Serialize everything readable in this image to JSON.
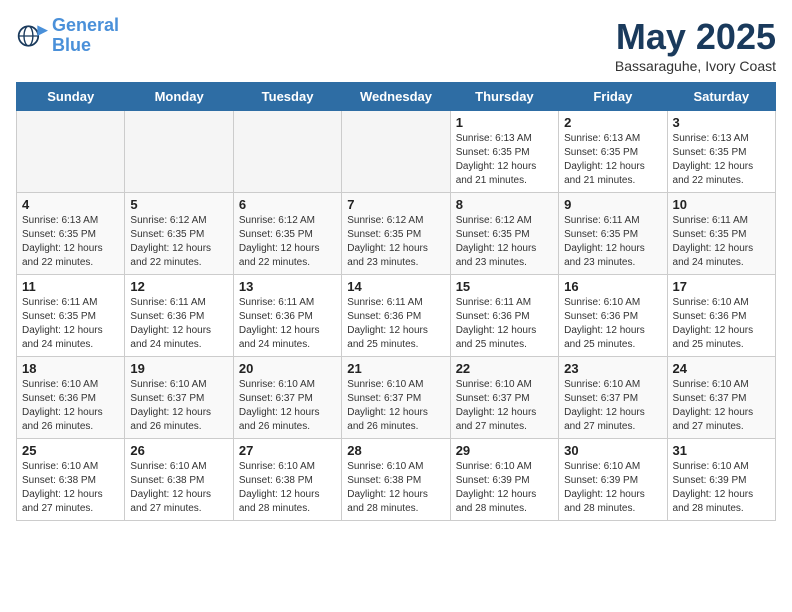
{
  "header": {
    "logo_line1": "General",
    "logo_line2": "Blue",
    "month": "May 2025",
    "location": "Bassaraguhe, Ivory Coast"
  },
  "days_of_week": [
    "Sunday",
    "Monday",
    "Tuesday",
    "Wednesday",
    "Thursday",
    "Friday",
    "Saturday"
  ],
  "weeks": [
    [
      {
        "num": "",
        "info": "",
        "empty": true
      },
      {
        "num": "",
        "info": "",
        "empty": true
      },
      {
        "num": "",
        "info": "",
        "empty": true
      },
      {
        "num": "",
        "info": "",
        "empty": true
      },
      {
        "num": "1",
        "info": "Sunrise: 6:13 AM\nSunset: 6:35 PM\nDaylight: 12 hours\nand 21 minutes."
      },
      {
        "num": "2",
        "info": "Sunrise: 6:13 AM\nSunset: 6:35 PM\nDaylight: 12 hours\nand 21 minutes."
      },
      {
        "num": "3",
        "info": "Sunrise: 6:13 AM\nSunset: 6:35 PM\nDaylight: 12 hours\nand 22 minutes."
      }
    ],
    [
      {
        "num": "4",
        "info": "Sunrise: 6:13 AM\nSunset: 6:35 PM\nDaylight: 12 hours\nand 22 minutes."
      },
      {
        "num": "5",
        "info": "Sunrise: 6:12 AM\nSunset: 6:35 PM\nDaylight: 12 hours\nand 22 minutes."
      },
      {
        "num": "6",
        "info": "Sunrise: 6:12 AM\nSunset: 6:35 PM\nDaylight: 12 hours\nand 22 minutes."
      },
      {
        "num": "7",
        "info": "Sunrise: 6:12 AM\nSunset: 6:35 PM\nDaylight: 12 hours\nand 23 minutes."
      },
      {
        "num": "8",
        "info": "Sunrise: 6:12 AM\nSunset: 6:35 PM\nDaylight: 12 hours\nand 23 minutes."
      },
      {
        "num": "9",
        "info": "Sunrise: 6:11 AM\nSunset: 6:35 PM\nDaylight: 12 hours\nand 23 minutes."
      },
      {
        "num": "10",
        "info": "Sunrise: 6:11 AM\nSunset: 6:35 PM\nDaylight: 12 hours\nand 24 minutes."
      }
    ],
    [
      {
        "num": "11",
        "info": "Sunrise: 6:11 AM\nSunset: 6:35 PM\nDaylight: 12 hours\nand 24 minutes."
      },
      {
        "num": "12",
        "info": "Sunrise: 6:11 AM\nSunset: 6:36 PM\nDaylight: 12 hours\nand 24 minutes."
      },
      {
        "num": "13",
        "info": "Sunrise: 6:11 AM\nSunset: 6:36 PM\nDaylight: 12 hours\nand 24 minutes."
      },
      {
        "num": "14",
        "info": "Sunrise: 6:11 AM\nSunset: 6:36 PM\nDaylight: 12 hours\nand 25 minutes."
      },
      {
        "num": "15",
        "info": "Sunrise: 6:11 AM\nSunset: 6:36 PM\nDaylight: 12 hours\nand 25 minutes."
      },
      {
        "num": "16",
        "info": "Sunrise: 6:10 AM\nSunset: 6:36 PM\nDaylight: 12 hours\nand 25 minutes."
      },
      {
        "num": "17",
        "info": "Sunrise: 6:10 AM\nSunset: 6:36 PM\nDaylight: 12 hours\nand 25 minutes."
      }
    ],
    [
      {
        "num": "18",
        "info": "Sunrise: 6:10 AM\nSunset: 6:36 PM\nDaylight: 12 hours\nand 26 minutes."
      },
      {
        "num": "19",
        "info": "Sunrise: 6:10 AM\nSunset: 6:37 PM\nDaylight: 12 hours\nand 26 minutes."
      },
      {
        "num": "20",
        "info": "Sunrise: 6:10 AM\nSunset: 6:37 PM\nDaylight: 12 hours\nand 26 minutes."
      },
      {
        "num": "21",
        "info": "Sunrise: 6:10 AM\nSunset: 6:37 PM\nDaylight: 12 hours\nand 26 minutes."
      },
      {
        "num": "22",
        "info": "Sunrise: 6:10 AM\nSunset: 6:37 PM\nDaylight: 12 hours\nand 27 minutes."
      },
      {
        "num": "23",
        "info": "Sunrise: 6:10 AM\nSunset: 6:37 PM\nDaylight: 12 hours\nand 27 minutes."
      },
      {
        "num": "24",
        "info": "Sunrise: 6:10 AM\nSunset: 6:37 PM\nDaylight: 12 hours\nand 27 minutes."
      }
    ],
    [
      {
        "num": "25",
        "info": "Sunrise: 6:10 AM\nSunset: 6:38 PM\nDaylight: 12 hours\nand 27 minutes."
      },
      {
        "num": "26",
        "info": "Sunrise: 6:10 AM\nSunset: 6:38 PM\nDaylight: 12 hours\nand 27 minutes."
      },
      {
        "num": "27",
        "info": "Sunrise: 6:10 AM\nSunset: 6:38 PM\nDaylight: 12 hours\nand 28 minutes."
      },
      {
        "num": "28",
        "info": "Sunrise: 6:10 AM\nSunset: 6:38 PM\nDaylight: 12 hours\nand 28 minutes."
      },
      {
        "num": "29",
        "info": "Sunrise: 6:10 AM\nSunset: 6:39 PM\nDaylight: 12 hours\nand 28 minutes."
      },
      {
        "num": "30",
        "info": "Sunrise: 6:10 AM\nSunset: 6:39 PM\nDaylight: 12 hours\nand 28 minutes."
      },
      {
        "num": "31",
        "info": "Sunrise: 6:10 AM\nSunset: 6:39 PM\nDaylight: 12 hours\nand 28 minutes."
      }
    ]
  ]
}
